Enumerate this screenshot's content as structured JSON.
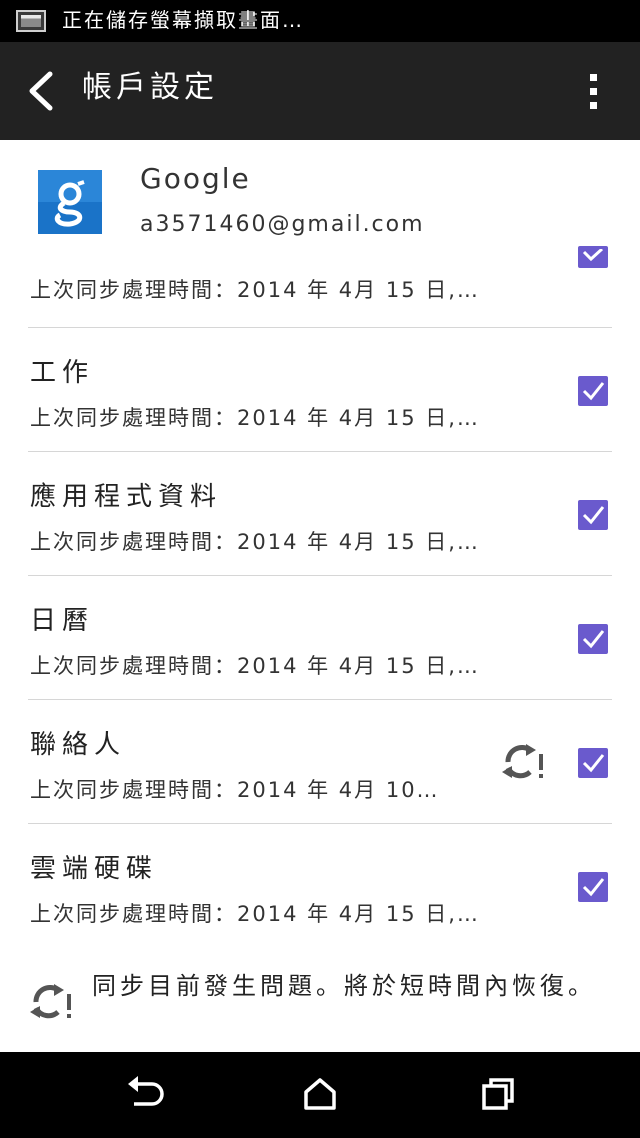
{
  "status_bar": {
    "text": "正在儲存螢幕擷取畫面…"
  },
  "app_bar": {
    "title": "帳戶設定"
  },
  "account": {
    "provider": "Google",
    "email": "a3571460@gmail.com"
  },
  "sync_items": [
    {
      "label": "",
      "sub": "上次同步處理時間：2014 年 4月 15 日,…",
      "checked": true
    },
    {
      "label": "工作",
      "sub": "上次同步處理時間：2014 年 4月 15 日,…",
      "checked": true
    },
    {
      "label": "應用程式資料",
      "sub": "上次同步處理時間：2014 年 4月 15 日,…",
      "checked": true
    },
    {
      "label": "日曆",
      "sub": "上次同步處理時間：2014 年 4月 15 日,…",
      "checked": true
    },
    {
      "label": "聯絡人",
      "sub": "上次同步處理時間：2014 年 4月 10…",
      "checked": true
    },
    {
      "label": "雲端硬碟",
      "sub": "上次同步處理時間：2014 年 4月 15 日,…",
      "checked": true
    }
  ],
  "footer": {
    "message": "同步目前發生問題。將於短時間內恢復。"
  },
  "colors": {
    "accent": "#6a5acd",
    "app_bar": "#222222",
    "google_blue": "#1a73c8"
  },
  "icons": {
    "back": "chevron-left-icon",
    "overflow": "more-vertical-icon",
    "sync_problem": "sync-problem-icon",
    "nav_back": "back-arrow-icon",
    "nav_home": "home-icon",
    "nav_recents": "recents-icon"
  }
}
